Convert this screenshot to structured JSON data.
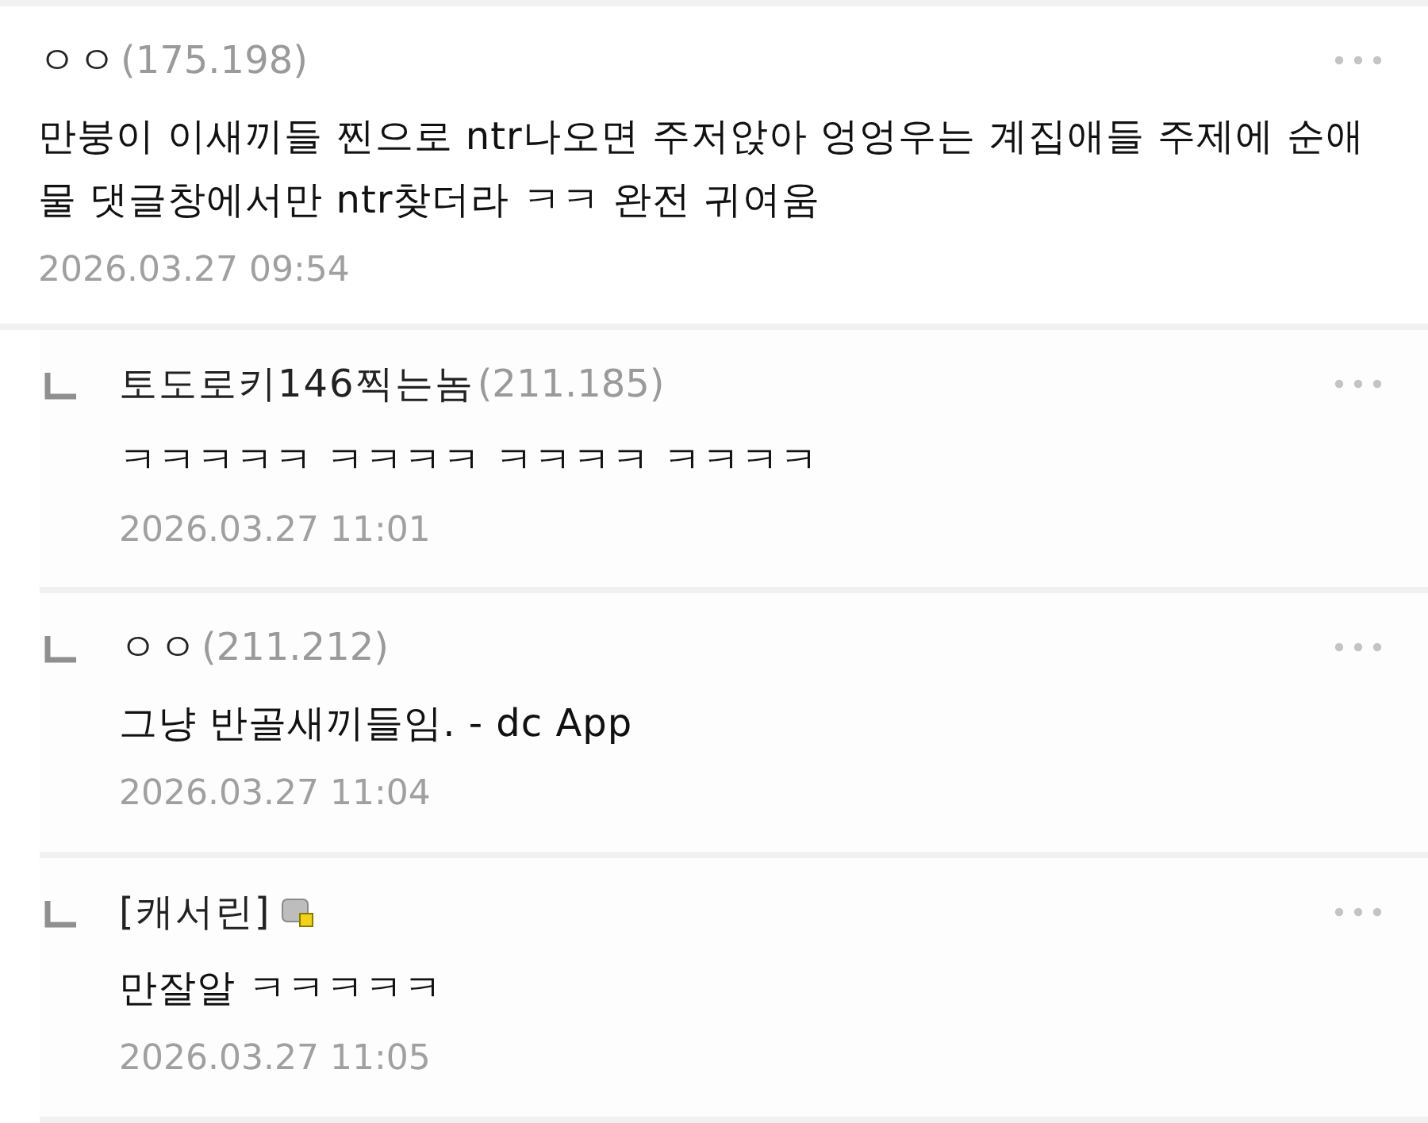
{
  "comments": [
    {
      "kind": "comment",
      "nickname": "ㅇㅇ",
      "ip": "(175.198)",
      "body": "만붕이 이새끼들 찐으로 ntr나오면 주저앉아 엉엉우는 계집애들 주제에 순애물 댓글창에서만 ntr찾더라 ㅋㅋ 완전 귀여움",
      "date": "2026.03.27 09:54"
    },
    {
      "kind": "reply",
      "nickname": "토도로키146찍는놈",
      "ip": "(211.185)",
      "body": "ㅋㅋㅋㅋㅋ ㅋㅋㅋㅋ ㅋㅋㅋㅋ ㅋㅋㅋㅋ",
      "date": "2026.03.27 11:01"
    },
    {
      "kind": "reply",
      "nickname": "ㅇㅇ",
      "ip": "(211.212)",
      "body": "그냥 반골새끼들임. - dc App",
      "date": "2026.03.27 11:04"
    },
    {
      "kind": "reply",
      "nickname": "[캐서린]",
      "member_icon": true,
      "body": "만잘알 ㅋㅋㅋㅋㅋ",
      "date": "2026.03.27 11:05"
    }
  ]
}
